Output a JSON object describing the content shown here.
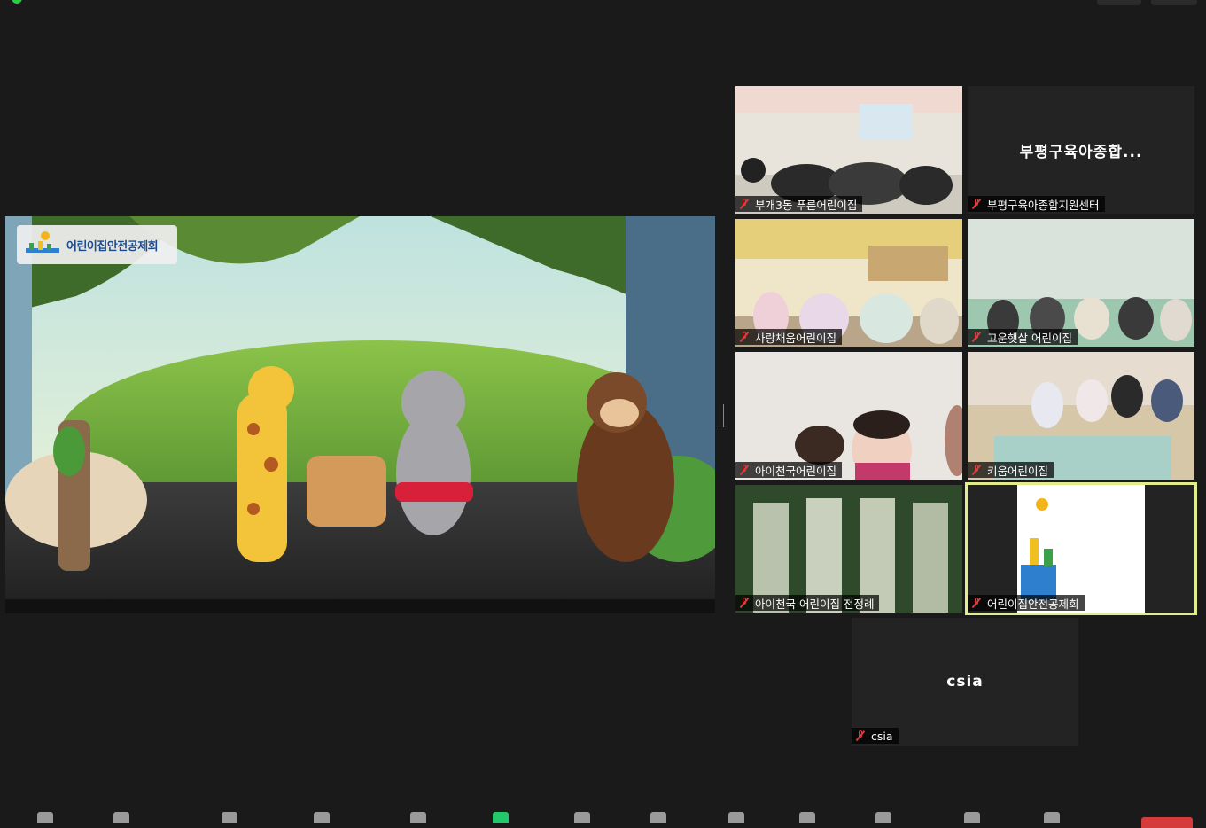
{
  "shared_screen": {
    "logo_text": "어린이집안전공제회"
  },
  "participants": [
    {
      "name": "부개3동 푸른어린이집",
      "muted": true,
      "video": true
    },
    {
      "name": "부평구육아종합지원센터",
      "display_label": "부평구육아종합...",
      "muted": true,
      "video": false
    },
    {
      "name": "사랑채움어린이집",
      "muted": true,
      "video": true
    },
    {
      "name": "고운햇살 어린이집",
      "muted": true,
      "video": true
    },
    {
      "name": "아이천국어린이집",
      "muted": true,
      "video": true
    },
    {
      "name": "키움어린이집",
      "muted": true,
      "video": true
    },
    {
      "name": "아이천국 어린이집 전정례",
      "muted": true,
      "video": true
    },
    {
      "name": "어린이집안전공제회",
      "muted": true,
      "video": true,
      "active_speaker": true
    },
    {
      "name": "csia",
      "display_label": "csia",
      "muted": true,
      "video": false
    }
  ],
  "colors": {
    "background": "#1a1a1a",
    "tile_background": "#232323",
    "active_speaker_border": "#e3ec8c",
    "muted_icon": "#e03a3a"
  },
  "icons": [
    "mic-off-icon",
    "shield-icon"
  ]
}
